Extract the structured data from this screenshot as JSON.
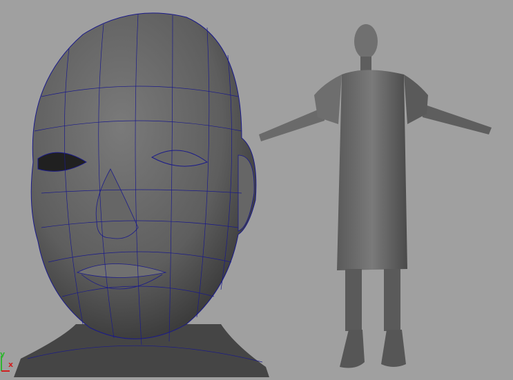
{
  "viewport": {
    "background": "#a0a0a0",
    "mesh_color": "#5a5a5a",
    "wire_color": "#1a1a8a"
  },
  "axis_gizmo": {
    "y_label": "y",
    "x_label": "x",
    "y_color": "#2fb52f",
    "x_color": "#d02020"
  }
}
